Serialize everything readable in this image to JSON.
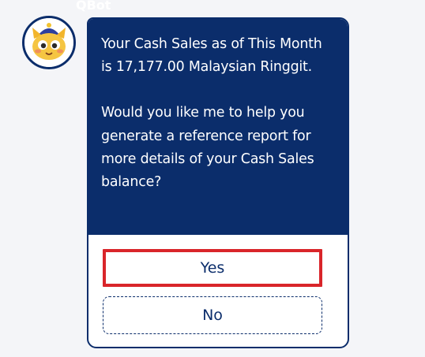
{
  "bot": {
    "name": "QBot",
    "avatar_icon": "cat-mascot-icon"
  },
  "message": {
    "paragraph_1": "Your Cash Sales as of This Month is 17,177.00 Malaysian Ringgit.",
    "paragraph_2": "Would you like me to help you generate a reference report for more details of your Cash Sales balance?"
  },
  "choices": {
    "yes_label": "Yes",
    "no_label": "No"
  },
  "colors": {
    "brand_navy": "#0b2d6b",
    "highlight_red": "#d9252a",
    "page_background": "#f4f5f8"
  }
}
